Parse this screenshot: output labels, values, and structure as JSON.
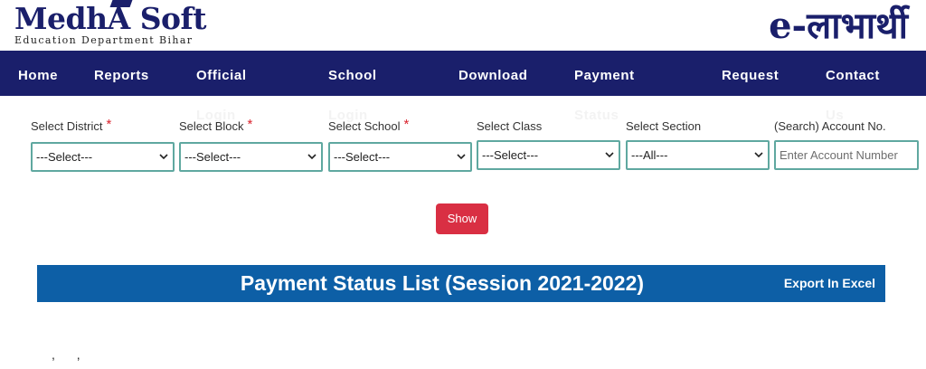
{
  "header": {
    "logo_main_1": "Medh",
    "logo_main_cap": "A",
    "logo_main_2": " Soft",
    "logo_sub": "Education Department Bihar",
    "brand_right": "e-लाभार्थी"
  },
  "nav": {
    "items": [
      {
        "label": "Home"
      },
      {
        "label": "Reports"
      },
      {
        "label": "Official",
        "overflow": "Login"
      },
      {
        "label": "School",
        "overflow": "Login"
      },
      {
        "label": "Download"
      },
      {
        "label": "Payment",
        "overflow": "Status"
      },
      {
        "label": "Request"
      },
      {
        "label": "Contact",
        "overflow": "Us"
      }
    ]
  },
  "form": {
    "district": {
      "label": "Select District",
      "value": "---Select---"
    },
    "block": {
      "label": "Select Block",
      "value": "---Select---"
    },
    "school": {
      "label": "Select School",
      "value": "---Select---"
    },
    "class": {
      "label": "Select Class",
      "value": "---Select---"
    },
    "section": {
      "label": "Select Section",
      "value": "---All---"
    },
    "account": {
      "label": "(Search) Account No.",
      "placeholder": "Enter Account Number"
    },
    "required_mark": "*"
  },
  "actions": {
    "show_label": "Show"
  },
  "status_bar": {
    "title": "Payment Status List (Session 2021-2022)",
    "export_label": "Export In Excel"
  },
  "footer": {
    "stray_text": ", ,"
  },
  "colors": {
    "navy": "#1a1f6b",
    "accent_red": "#d92f43",
    "status_blue": "#0d5fa6",
    "field_border": "#5fa8a0"
  }
}
